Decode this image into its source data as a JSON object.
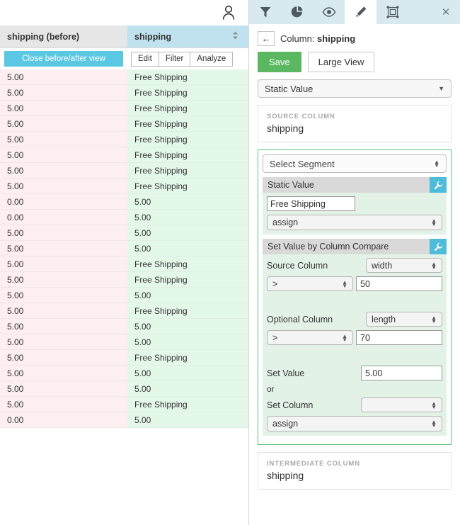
{
  "grid": {
    "user_icon": "user-icon",
    "columns": [
      {
        "title": "shipping (before)",
        "kind": "before"
      },
      {
        "title": "shipping",
        "kind": "after",
        "sort_icon": "sort-icon"
      }
    ],
    "close_before_after_label": "Close before/after view",
    "action_buttons": [
      "Edit",
      "Filter",
      "Analyze"
    ],
    "rows": [
      {
        "before": "5.00",
        "after": "Free Shipping"
      },
      {
        "before": "5.00",
        "after": "Free Shipping"
      },
      {
        "before": "5.00",
        "after": "Free Shipping"
      },
      {
        "before": "5.00",
        "after": "Free Shipping"
      },
      {
        "before": "5.00",
        "after": "Free Shipping"
      },
      {
        "before": "5.00",
        "after": "Free Shipping"
      },
      {
        "before": "5.00",
        "after": "Free Shipping"
      },
      {
        "before": "5.00",
        "after": "Free Shipping"
      },
      {
        "before": "0.00",
        "after": "5.00"
      },
      {
        "before": "0.00",
        "after": "5.00"
      },
      {
        "before": "5.00",
        "after": "5.00"
      },
      {
        "before": "5.00",
        "after": "5.00"
      },
      {
        "before": "5.00",
        "after": "Free Shipping"
      },
      {
        "before": "5.00",
        "after": "Free Shipping"
      },
      {
        "before": "5.00",
        "after": "5.00"
      },
      {
        "before": "5.00",
        "after": "Free Shipping"
      },
      {
        "before": "5.00",
        "after": "5.00"
      },
      {
        "before": "5.00",
        "after": "5.00"
      },
      {
        "before": "5.00",
        "after": "Free Shipping"
      },
      {
        "before": "5.00",
        "after": "5.00"
      },
      {
        "before": "5.00",
        "after": "5.00"
      },
      {
        "before": "5.00",
        "after": "Free Shipping"
      },
      {
        "before": "0.00",
        "after": "5.00"
      }
    ]
  },
  "panel": {
    "tabs": [
      {
        "icon": "filter-icon",
        "active": false
      },
      {
        "icon": "pie-chart-icon",
        "active": false
      },
      {
        "icon": "eye-icon",
        "active": false
      },
      {
        "icon": "pencil-icon",
        "active": true
      },
      {
        "icon": "transform-icon",
        "active": false
      }
    ],
    "close_icon": "✕",
    "back_icon": "←",
    "title_prefix": "Column: ",
    "title_column": "shipping",
    "save_label": "Save",
    "large_view_label": "Large View",
    "mode_select": {
      "value": "Static Value",
      "caret": "▼"
    },
    "source_column": {
      "label": "SOURCE COLUMN",
      "value": "shipping"
    },
    "segment_select": {
      "value": "Select Segment"
    },
    "static_value_rule": {
      "title": "Static Value",
      "wrench_icon": "wrench-icon",
      "value": "Free Shipping",
      "assign": "assign"
    },
    "column_compare_rule": {
      "title": "Set Value by Column Compare",
      "wrench_icon": "wrench-icon",
      "source_column_label": "Source Column",
      "source_column_value": "width",
      "source_operator": ">",
      "source_operand": "50",
      "optional_column_label": "Optional Column",
      "optional_column_value": "length",
      "optional_operator": ">",
      "optional_operand": "70",
      "set_value_label": "Set Value",
      "set_value": "5.00",
      "or_label": "or",
      "set_column_label": "Set Column",
      "set_column_value": "",
      "assign": "assign"
    },
    "intermediate_column": {
      "label": "INTERMEDIATE COLUMN",
      "value": "shipping"
    }
  },
  "colors": {
    "accent_blue": "#5ac8e2",
    "header_after": "#bfe2ee",
    "header_before": "#e6e6e6",
    "cell_before": "#fdeef0",
    "cell_after": "#e4f8ea",
    "save_green": "#5cb860",
    "frame_green": "#5cc07c",
    "tab_inactive": "#d9e9f0"
  }
}
